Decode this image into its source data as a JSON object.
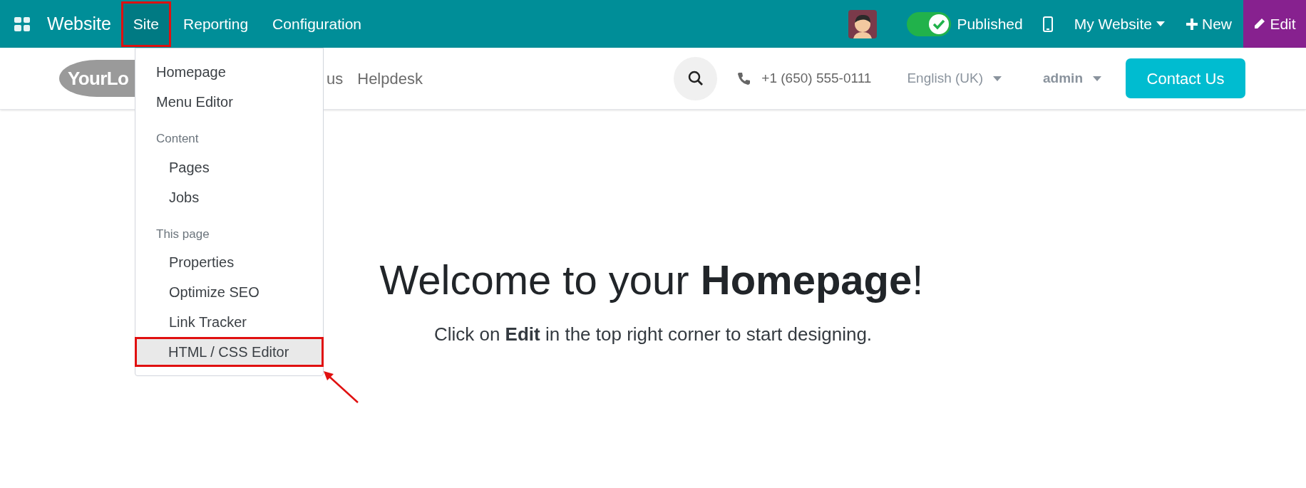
{
  "top_bar": {
    "app_name": "Website",
    "menus": [
      {
        "label": "Site",
        "selected": true
      },
      {
        "label": "Reporting",
        "selected": false
      },
      {
        "label": "Configuration",
        "selected": false
      }
    ],
    "published": {
      "label": "Published",
      "on": true
    },
    "website": "My Website",
    "new": "New",
    "edit": "Edit"
  },
  "site_header": {
    "logo": "YourLo",
    "nav": [
      "us",
      "Helpdesk"
    ],
    "phone": "+1 (650) 555-0111",
    "language": "English (UK)",
    "user": "admin",
    "cta": "Contact Us"
  },
  "site_menu": [
    {
      "kind": "item",
      "label": "Homepage",
      "highlighted": false
    },
    {
      "kind": "item",
      "label": "Menu Editor",
      "highlighted": false
    },
    {
      "kind": "header",
      "label": "Content"
    },
    {
      "kind": "subitem",
      "label": "Pages",
      "highlighted": false
    },
    {
      "kind": "subitem",
      "label": "Jobs",
      "highlighted": false
    },
    {
      "kind": "header",
      "label": "This page"
    },
    {
      "kind": "subitem",
      "label": "Properties",
      "highlighted": false
    },
    {
      "kind": "subitem",
      "label": "Optimize SEO",
      "highlighted": false
    },
    {
      "kind": "subitem",
      "label": "Link Tracker",
      "highlighted": false
    },
    {
      "kind": "subitem",
      "label": "HTML / CSS Editor",
      "highlighted": true
    }
  ],
  "content": {
    "heading": "Welcome to your **Homepage**!",
    "subtext": "Click on **Edit** in the top right corner to start designing."
  }
}
